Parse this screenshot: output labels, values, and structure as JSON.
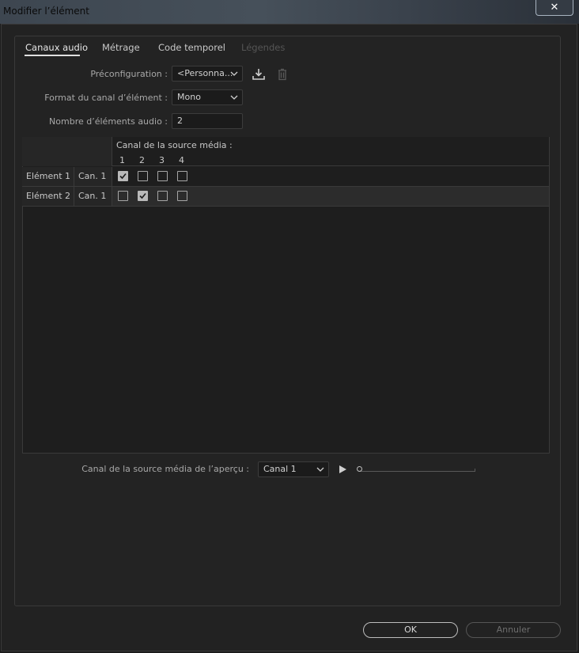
{
  "window": {
    "title": "Modifier l’élément",
    "close_label": "✕"
  },
  "tabs": [
    {
      "label": "Canaux audio",
      "state": "active"
    },
    {
      "label": "Métrage",
      "state": "normal"
    },
    {
      "label": "Code temporel",
      "state": "normal"
    },
    {
      "label": "Légendes",
      "state": "disabled"
    }
  ],
  "form": {
    "preset_label": "Préconfiguration :",
    "preset_value": "<Personna...",
    "channel_format_label": "Format du canal d’élément :",
    "channel_format_value": "Mono",
    "audio_count_label": "Nombre d’éléments audio :",
    "audio_count_value": "2"
  },
  "grid": {
    "source_header": "Canal de la source média :",
    "channel_numbers": [
      "1",
      "2",
      "3",
      "4"
    ],
    "rows": [
      {
        "element": "Elément 1",
        "channel": "Can. 1",
        "checks": [
          true,
          false,
          false,
          false
        ],
        "selected": false
      },
      {
        "element": "Elément 2",
        "channel": "Can. 1",
        "checks": [
          false,
          true,
          false,
          false
        ],
        "selected": true
      }
    ]
  },
  "preview": {
    "label": "Canal de la source média de l’aperçu :",
    "channel_value": "Canal 1",
    "progress": 0
  },
  "buttons": {
    "ok": "OK",
    "cancel": "Annuler"
  },
  "icons": {
    "save_preset": "download-icon",
    "delete_preset": "trash-icon",
    "play": "play-icon"
  },
  "colors": {
    "background": "#222222",
    "accent": "#e0e0e0"
  }
}
